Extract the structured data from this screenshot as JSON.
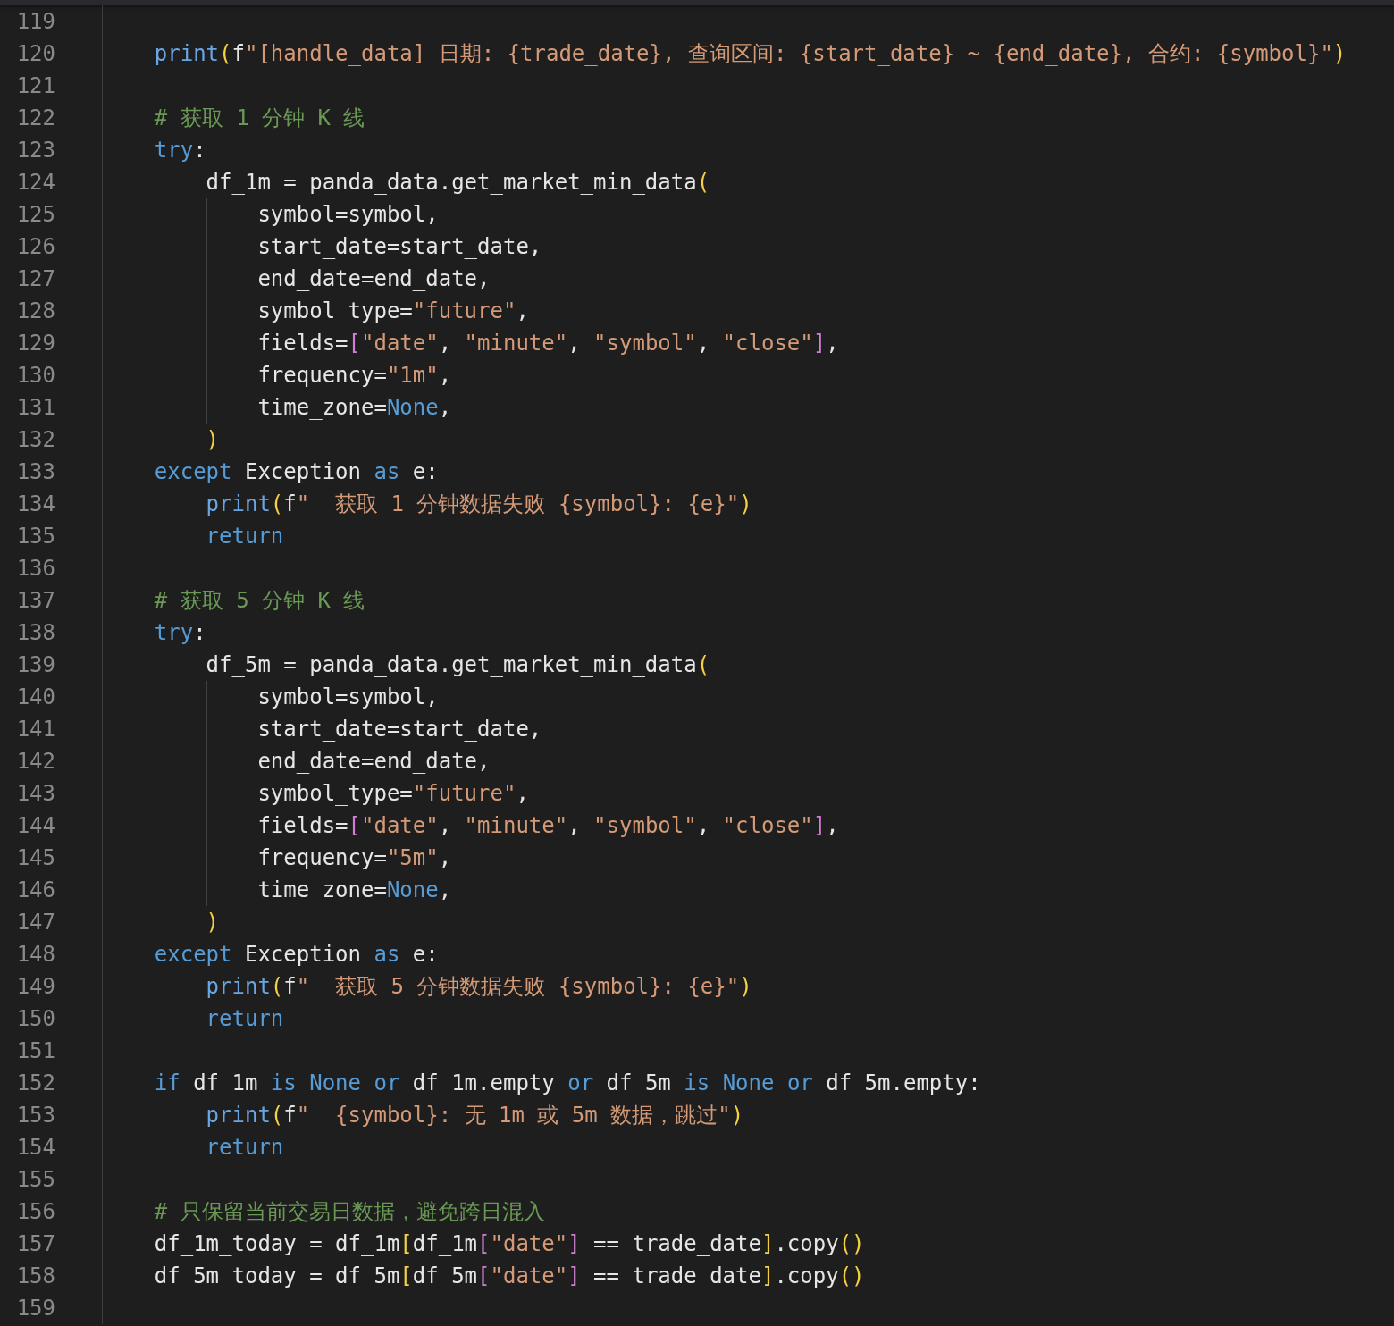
{
  "lines": [
    {
      "number": "119"
    },
    {
      "number": "120",
      "tokens": [
        {
          "kind": "fn",
          "text": "    print"
        },
        {
          "kind": "paren",
          "text": "("
        },
        {
          "kind": "plain",
          "text": "f"
        },
        {
          "kind": "str",
          "text": "\"[handle_data] 日期: {trade_date}, 查询区间: {start_date} ~ {end_date}, 合约: {symbol}\""
        },
        {
          "kind": "paren",
          "text": ")"
        }
      ]
    },
    {
      "number": "121"
    },
    {
      "number": "122",
      "tokens": [
        {
          "kind": "comment",
          "text": "    # 获取 1 分钟 K 线"
        }
      ]
    },
    {
      "number": "123",
      "tokens": [
        {
          "kind": "kw",
          "text": "    try"
        },
        {
          "kind": "plain",
          "text": ":"
        }
      ]
    },
    {
      "number": "124",
      "tokens": [
        {
          "kind": "plain",
          "text": "        df_1m = panda_data.get_market_min_data"
        },
        {
          "kind": "paren",
          "text": "("
        }
      ]
    },
    {
      "number": "125",
      "tokens": [
        {
          "kind": "plain",
          "text": "            symbol=symbol,"
        }
      ]
    },
    {
      "number": "126",
      "tokens": [
        {
          "kind": "plain",
          "text": "            start_date=start_date,"
        }
      ]
    },
    {
      "number": "127",
      "tokens": [
        {
          "kind": "plain",
          "text": "            end_date=end_date,"
        }
      ]
    },
    {
      "number": "128",
      "tokens": [
        {
          "kind": "plain",
          "text": "            symbol_type="
        },
        {
          "kind": "str",
          "text": "\"future\""
        },
        {
          "kind": "plain",
          "text": ","
        }
      ]
    },
    {
      "number": "129",
      "tokens": [
        {
          "kind": "plain",
          "text": "            fields="
        },
        {
          "kind": "bracket",
          "text": "["
        },
        {
          "kind": "str",
          "text": "\"date\""
        },
        {
          "kind": "plain",
          "text": ", "
        },
        {
          "kind": "str",
          "text": "\"minute\""
        },
        {
          "kind": "plain",
          "text": ", "
        },
        {
          "kind": "str",
          "text": "\"symbol\""
        },
        {
          "kind": "plain",
          "text": ", "
        },
        {
          "kind": "str",
          "text": "\"close\""
        },
        {
          "kind": "bracket",
          "text": "]"
        },
        {
          "kind": "plain",
          "text": ","
        }
      ]
    },
    {
      "number": "130",
      "tokens": [
        {
          "kind": "plain",
          "text": "            frequency="
        },
        {
          "kind": "str",
          "text": "\"1m\""
        },
        {
          "kind": "plain",
          "text": ","
        }
      ]
    },
    {
      "number": "131",
      "tokens": [
        {
          "kind": "plain",
          "text": "            time_zone="
        },
        {
          "kind": "const",
          "text": "None"
        },
        {
          "kind": "plain",
          "text": ","
        }
      ]
    },
    {
      "number": "132",
      "tokens": [
        {
          "kind": "paren",
          "text": "        )"
        }
      ]
    },
    {
      "number": "133",
      "tokens": [
        {
          "kind": "kw",
          "text": "    except"
        },
        {
          "kind": "plain",
          "text": " Exception "
        },
        {
          "kind": "kw",
          "text": "as"
        },
        {
          "kind": "plain",
          "text": " e:"
        }
      ]
    },
    {
      "number": "134",
      "tokens": [
        {
          "kind": "fn",
          "text": "        print"
        },
        {
          "kind": "paren",
          "text": "("
        },
        {
          "kind": "plain",
          "text": "f"
        },
        {
          "kind": "str",
          "text": "\"  获取 1 分钟数据失败 {symbol}: {e}\""
        },
        {
          "kind": "paren",
          "text": ")"
        }
      ]
    },
    {
      "number": "135",
      "tokens": [
        {
          "kind": "kw",
          "text": "        return"
        }
      ]
    },
    {
      "number": "136"
    },
    {
      "number": "137",
      "tokens": [
        {
          "kind": "comment",
          "text": "    # 获取 5 分钟 K 线"
        }
      ]
    },
    {
      "number": "138",
      "tokens": [
        {
          "kind": "kw",
          "text": "    try"
        },
        {
          "kind": "plain",
          "text": ":"
        }
      ]
    },
    {
      "number": "139",
      "tokens": [
        {
          "kind": "plain",
          "text": "        df_5m = panda_data.get_market_min_data"
        },
        {
          "kind": "paren",
          "text": "("
        }
      ]
    },
    {
      "number": "140",
      "tokens": [
        {
          "kind": "plain",
          "text": "            symbol=symbol,"
        }
      ]
    },
    {
      "number": "141",
      "tokens": [
        {
          "kind": "plain",
          "text": "            start_date=start_date,"
        }
      ]
    },
    {
      "number": "142",
      "tokens": [
        {
          "kind": "plain",
          "text": "            end_date=end_date,"
        }
      ]
    },
    {
      "number": "143",
      "tokens": [
        {
          "kind": "plain",
          "text": "            symbol_type="
        },
        {
          "kind": "str",
          "text": "\"future\""
        },
        {
          "kind": "plain",
          "text": ","
        }
      ]
    },
    {
      "number": "144",
      "tokens": [
        {
          "kind": "plain",
          "text": "            fields="
        },
        {
          "kind": "bracket",
          "text": "["
        },
        {
          "kind": "str",
          "text": "\"date\""
        },
        {
          "kind": "plain",
          "text": ", "
        },
        {
          "kind": "str",
          "text": "\"minute\""
        },
        {
          "kind": "plain",
          "text": ", "
        },
        {
          "kind": "str",
          "text": "\"symbol\""
        },
        {
          "kind": "plain",
          "text": ", "
        },
        {
          "kind": "str",
          "text": "\"close\""
        },
        {
          "kind": "bracket",
          "text": "]"
        },
        {
          "kind": "plain",
          "text": ","
        }
      ]
    },
    {
      "number": "145",
      "tokens": [
        {
          "kind": "plain",
          "text": "            frequency="
        },
        {
          "kind": "str",
          "text": "\"5m\""
        },
        {
          "kind": "plain",
          "text": ","
        }
      ]
    },
    {
      "number": "146",
      "tokens": [
        {
          "kind": "plain",
          "text": "            time_zone="
        },
        {
          "kind": "const",
          "text": "None"
        },
        {
          "kind": "plain",
          "text": ","
        }
      ]
    },
    {
      "number": "147",
      "tokens": [
        {
          "kind": "paren",
          "text": "        )"
        }
      ]
    },
    {
      "number": "148",
      "tokens": [
        {
          "kind": "kw",
          "text": "    except"
        },
        {
          "kind": "plain",
          "text": " Exception "
        },
        {
          "kind": "kw",
          "text": "as"
        },
        {
          "kind": "plain",
          "text": " e:"
        }
      ]
    },
    {
      "number": "149",
      "tokens": [
        {
          "kind": "fn",
          "text": "        print"
        },
        {
          "kind": "paren",
          "text": "("
        },
        {
          "kind": "plain",
          "text": "f"
        },
        {
          "kind": "str",
          "text": "\"  获取 5 分钟数据失败 {symbol}: {e}\""
        },
        {
          "kind": "paren",
          "text": ")"
        }
      ]
    },
    {
      "number": "150",
      "tokens": [
        {
          "kind": "kw",
          "text": "        return"
        }
      ]
    },
    {
      "number": "151"
    },
    {
      "number": "152",
      "tokens": [
        {
          "kind": "kw",
          "text": "    if"
        },
        {
          "kind": "plain",
          "text": " df_1m "
        },
        {
          "kind": "kw",
          "text": "is "
        },
        {
          "kind": "const",
          "text": "None"
        },
        {
          "kind": "kw",
          "text": " or"
        },
        {
          "kind": "plain",
          "text": " df_1m.empty "
        },
        {
          "kind": "kw",
          "text": "or"
        },
        {
          "kind": "plain",
          "text": " df_5m "
        },
        {
          "kind": "kw",
          "text": "is "
        },
        {
          "kind": "const",
          "text": "None"
        },
        {
          "kind": "kw",
          "text": " or"
        },
        {
          "kind": "plain",
          "text": " df_5m.empty:"
        }
      ]
    },
    {
      "number": "153",
      "tokens": [
        {
          "kind": "fn",
          "text": "        print"
        },
        {
          "kind": "paren",
          "text": "("
        },
        {
          "kind": "plain",
          "text": "f"
        },
        {
          "kind": "str",
          "text": "\"  {symbol}: 无 1m 或 5m 数据，跳过\""
        },
        {
          "kind": "paren",
          "text": ")"
        }
      ]
    },
    {
      "number": "154",
      "tokens": [
        {
          "kind": "kw",
          "text": "        return"
        }
      ]
    },
    {
      "number": "155"
    },
    {
      "number": "156",
      "tokens": [
        {
          "kind": "comment",
          "text": "    # 只保留当前交易日数据，避免跨日混入"
        }
      ]
    },
    {
      "number": "157",
      "tokens": [
        {
          "kind": "plain",
          "text": "    df_1m_today = df_1m"
        },
        {
          "kind": "paren",
          "text": "["
        },
        {
          "kind": "plain",
          "text": "df_1m"
        },
        {
          "kind": "bracket",
          "text": "["
        },
        {
          "kind": "str",
          "text": "\"date\""
        },
        {
          "kind": "bracket",
          "text": "]"
        },
        {
          "kind": "plain",
          "text": " == trade_date"
        },
        {
          "kind": "paren",
          "text": "]"
        },
        {
          "kind": "plain",
          "text": ".copy"
        },
        {
          "kind": "paren",
          "text": "()"
        }
      ]
    },
    {
      "number": "158",
      "tokens": [
        {
          "kind": "plain",
          "text": "    df_5m_today = df_5m"
        },
        {
          "kind": "paren",
          "text": "["
        },
        {
          "kind": "plain",
          "text": "df_5m"
        },
        {
          "kind": "bracket",
          "text": "["
        },
        {
          "kind": "str",
          "text": "\"date\""
        },
        {
          "kind": "bracket",
          "text": "]"
        },
        {
          "kind": "plain",
          "text": " == trade_date"
        },
        {
          "kind": "paren",
          "text": "]"
        },
        {
          "kind": "plain",
          "text": ".copy"
        },
        {
          "kind": "paren",
          "text": "()"
        }
      ]
    },
    {
      "number": "159"
    }
  ]
}
